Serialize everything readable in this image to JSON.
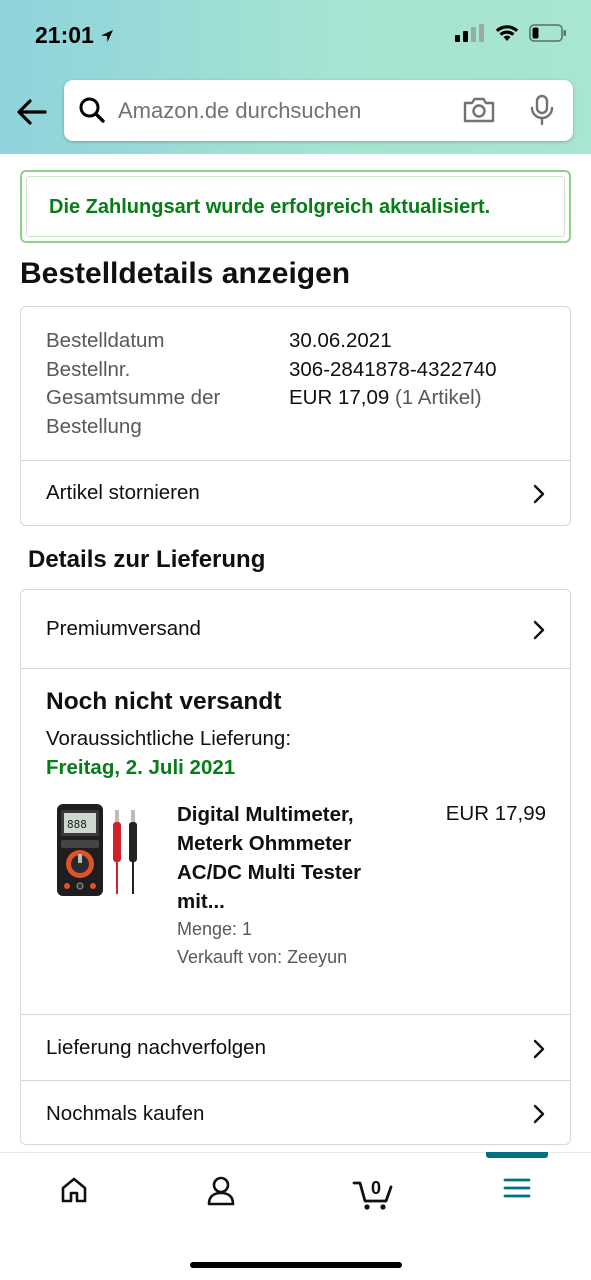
{
  "status_bar": {
    "time": "21:01"
  },
  "search": {
    "placeholder": "Amazon.de durchsuchen"
  },
  "alert": {
    "message": "Die Zahlungsart wurde erfolgreich aktualisiert."
  },
  "page": {
    "title": "Bestelldetails anzeigen"
  },
  "order": {
    "date_label": "Bestelldatum",
    "date_value": "30.06.2021",
    "number_label": "Bestellnr.",
    "number_value": "306-2841878-4322740",
    "total_label_line1": "Gesamtsumme der",
    "total_label_line2": "Bestellung",
    "total_value": "EUR 17,09",
    "total_items": "(1 Artikel)",
    "cancel_label": "Artikel stornieren"
  },
  "delivery": {
    "section_title": "Details zur Lieferung",
    "shipping_method": "Premiumversand",
    "status": "Noch nicht versandt",
    "expected_label": "Voraussichtliche Lieferung:",
    "expected_date": "Freitag, 2. Juli 2021",
    "product": {
      "title": "Digital Multimeter, Meterk Ohmmeter AC/DC Multi Tester mit...",
      "price": "EUR 17,99",
      "quantity": "Menge: 1",
      "seller": "Verkauft von: Zeeyun"
    },
    "track_label": "Lieferung nachverfolgen",
    "buy_again_label": "Nochmals kaufen"
  },
  "bottom_nav": {
    "cart_count": "0",
    "items": [
      "home-icon",
      "account-icon",
      "cart-icon",
      "menu-icon"
    ],
    "active": "menu-icon",
    "accent_color": "#007185"
  },
  "colors": {
    "success_green": "#067d17",
    "header_gradient_start": "#8fd3dc",
    "header_gradient_end": "#a8e6cf"
  }
}
